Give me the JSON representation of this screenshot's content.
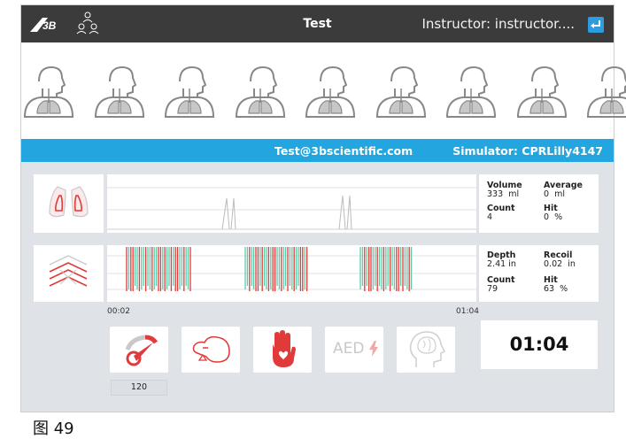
{
  "header": {
    "title": "Test",
    "instructor": "Instructor: instructor...."
  },
  "session": {
    "email": "Test@3bscientific.com",
    "simulator": "Simulator: CPRLilly4147"
  },
  "ventilation": {
    "volume_label": "Volume",
    "volume_value": "333",
    "volume_unit": "ml",
    "average_label": "Average",
    "average_value": "0",
    "average_unit": "ml",
    "count_label": "Count",
    "count_value": "4",
    "hit_label": "Hit",
    "hit_value": "0",
    "hit_unit": "%"
  },
  "compression": {
    "depth_label": "Depth",
    "depth_value": "2.41",
    "depth_unit": "in",
    "recoil_label": "Recoil",
    "recoil_value": "0.02",
    "recoil_unit": "in",
    "count_label": "Count",
    "count_value": "79",
    "hit_label": "Hit",
    "hit_value": "63",
    "hit_unit": "%"
  },
  "timeline": {
    "start": "00:02",
    "end": "01:04"
  },
  "controls": {
    "compression_rate": "120",
    "aed_label": "AED",
    "timer": "01:04"
  },
  "trainees": [
    "trainee-1",
    "trainee-2",
    "trainee-3",
    "trainee-4",
    "trainee-5",
    "trainee-6",
    "trainee-7",
    "trainee-8",
    "trainee-9"
  ],
  "colors": {
    "topbar": "#3b3b3b",
    "accent_blue": "#23a6df",
    "panel": "#dfe3e8",
    "red": "#e03a3a",
    "green": "#5fc9a8"
  },
  "caption": "图 49"
}
